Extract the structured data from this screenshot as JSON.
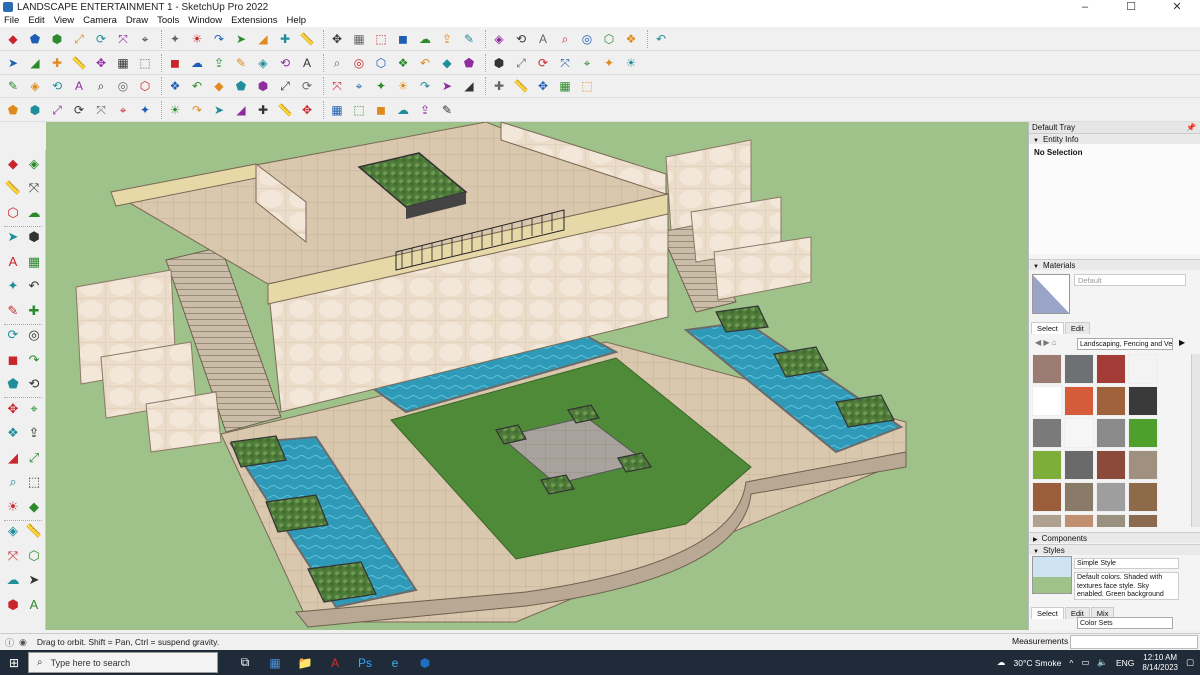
{
  "window": {
    "title": "LANDSCAPE ENTERTAINMENT 1 - SketchUp Pro 2022",
    "controls": [
      "–",
      "☐",
      "✕"
    ]
  },
  "menu": [
    "File",
    "Edit",
    "View",
    "Camera",
    "Draw",
    "Tools",
    "Window",
    "Extensions",
    "Help"
  ],
  "toolbar_rows": [
    {
      "name": "row1",
      "icons": [
        "zoom-icon",
        "select-icon",
        "eraser-icon",
        "pencil-icon",
        "line-icon",
        "paint-icon",
        "push-pull-icon",
        "move-icon",
        "rotate-icon",
        "scale-icon",
        "tape-icon",
        "text-icon",
        "orbit-icon",
        "pan-icon",
        "zoom-window-icon",
        "zoom-extents-icon",
        "sandbox-icon",
        "geo-icon",
        "camera-icon",
        "section-icon",
        "warehouse-icon",
        "extension-icon",
        "solid-icon",
        "component-icon",
        "shadow-icon",
        "fog-icon",
        "undo-icon",
        "redo-icon",
        "share-icon"
      ]
    },
    {
      "name": "row2",
      "icons": [
        "box-icon",
        "axes-icon",
        "iso-icon",
        "top-icon",
        "front-icon",
        "right-icon",
        "back-icon",
        "left-icon",
        "curve-icon",
        "edit-icon",
        "wall-icon",
        "stair-icon",
        "roof-icon",
        "home-icon",
        "window-icon",
        "door-icon",
        "hatch-icon",
        "group-icon",
        "shape-icon",
        "arc-icon",
        "hexagon-icon",
        "oval-icon",
        "star-icon",
        "polygon-icon",
        "ribbon-icon",
        "brick-icon",
        "roof-tile-icon",
        "stone-icon"
      ]
    },
    {
      "name": "row3",
      "icons": [
        "cube-icon",
        "solid-cube-icon",
        "tag-icon",
        "outliner-icon",
        "spiral-icon",
        "frame-icon",
        "plate-icon",
        "bracket-icon",
        "plus-icon",
        "cross-icon",
        "triangle-icon",
        "tree-icon",
        "fillet-icon",
        "offset-icon",
        "dimension-icon",
        "protractor-icon",
        "flip-icon",
        "array-icon",
        "extrude-icon",
        "skin-icon",
        "loft-icon",
        "slice-icon",
        "bevel-icon",
        "weld-icon",
        "round-icon",
        "chamfer-icon"
      ]
    },
    {
      "name": "row4",
      "icons": [
        "lights-icon",
        "render-icon",
        "material-icon",
        "follow-me-icon",
        "intersect-icon",
        "union-icon",
        "subtract-icon",
        "trim-icon",
        "split-icon",
        "profile-icon",
        "sweep-icon",
        "lattice-icon",
        "mesh-icon",
        "triangulate-icon",
        "quad-icon",
        "smooth-icon",
        "soften-icon",
        "unfold-icon",
        "grid-icon",
        "stack-icon"
      ]
    }
  ],
  "left_palette": {
    "icons": [
      "select-icon",
      "orbit-icon",
      "paint-bucket-icon",
      "eraser-icon",
      "component-icon",
      "pencil-icon",
      "line-icon",
      "freehand-icon",
      "rectangle-icon",
      "rotated-rect-icon",
      "circle-icon",
      "polygon-icon",
      "arc-icon",
      "pie-icon",
      "two-point-arc-icon",
      "three-point-arc-icon",
      "push-pull-icon",
      "follow-me-icon",
      "move-icon",
      "rotate-icon",
      "offset-icon",
      "scale-icon",
      "tape-icon",
      "text-icon",
      "protractor-icon",
      "dimension-icon",
      "orbit-tool-icon",
      "pan-icon",
      "zoom-icon",
      "zoom-window-icon",
      "zoom-extents-icon",
      "previous-icon",
      "walk-icon",
      "look-around-icon",
      "position-camera-icon",
      "section-plane-icon",
      "sandbox-icon",
      "warehouse-icon"
    ]
  },
  "viewport": {
    "background": "#9fc28a",
    "model": "landscape-entertainment-model"
  },
  "tray": {
    "title": "Default Tray",
    "entity_info": {
      "label": "Entity Info",
      "selection": "No Selection"
    },
    "materials": {
      "label": "Materials",
      "current": "Default",
      "tabs": [
        "Select",
        "Edit"
      ],
      "library": "Landscaping, Fencing and Vegetation",
      "swatch_colors": [
        "#9b7b72",
        "#6f7073",
        "#a33b36",
        "#f3f3f3",
        "#ffffff",
        "#d55b3a",
        "#a0623a",
        "#3a3a3a",
        "#7a7a7a",
        "#f6f6f6",
        "#8a8a8a",
        "#4ea02c",
        "#7dae3a",
        "#6a6a6a",
        "#8c4a3b",
        "#a09080",
        "#9a5e3d",
        "#8a7a68",
        "#9e9e9e",
        "#8d6a4a",
        "#b0a090",
        "#c09070",
        "#9a9080",
        "#8a6a50"
      ]
    },
    "components": {
      "label": "Components"
    },
    "styles": {
      "label": "Styles",
      "name": "Simple Style",
      "description": "Default colors.  Shaded with textures face style.  Sky enabled.  Green background",
      "tabs": [
        "Select",
        "Edit",
        "Mix"
      ],
      "collection": "Color Sets"
    }
  },
  "status": {
    "hint": "Drag to orbit. Shift = Pan, Ctrl = suspend gravity.",
    "measurements_label": "Measurements"
  },
  "taskbar": {
    "search_placeholder": "Type here to search",
    "apps": [
      "task-view-icon",
      "calculator-icon",
      "explorer-icon",
      "acrobat-icon",
      "photoshop-icon",
      "edge-icon",
      "sketchup-icon"
    ],
    "weather": "30°C  Smoke",
    "language": "ENG",
    "time": "12:10 AM",
    "date": "8/14/2023"
  }
}
